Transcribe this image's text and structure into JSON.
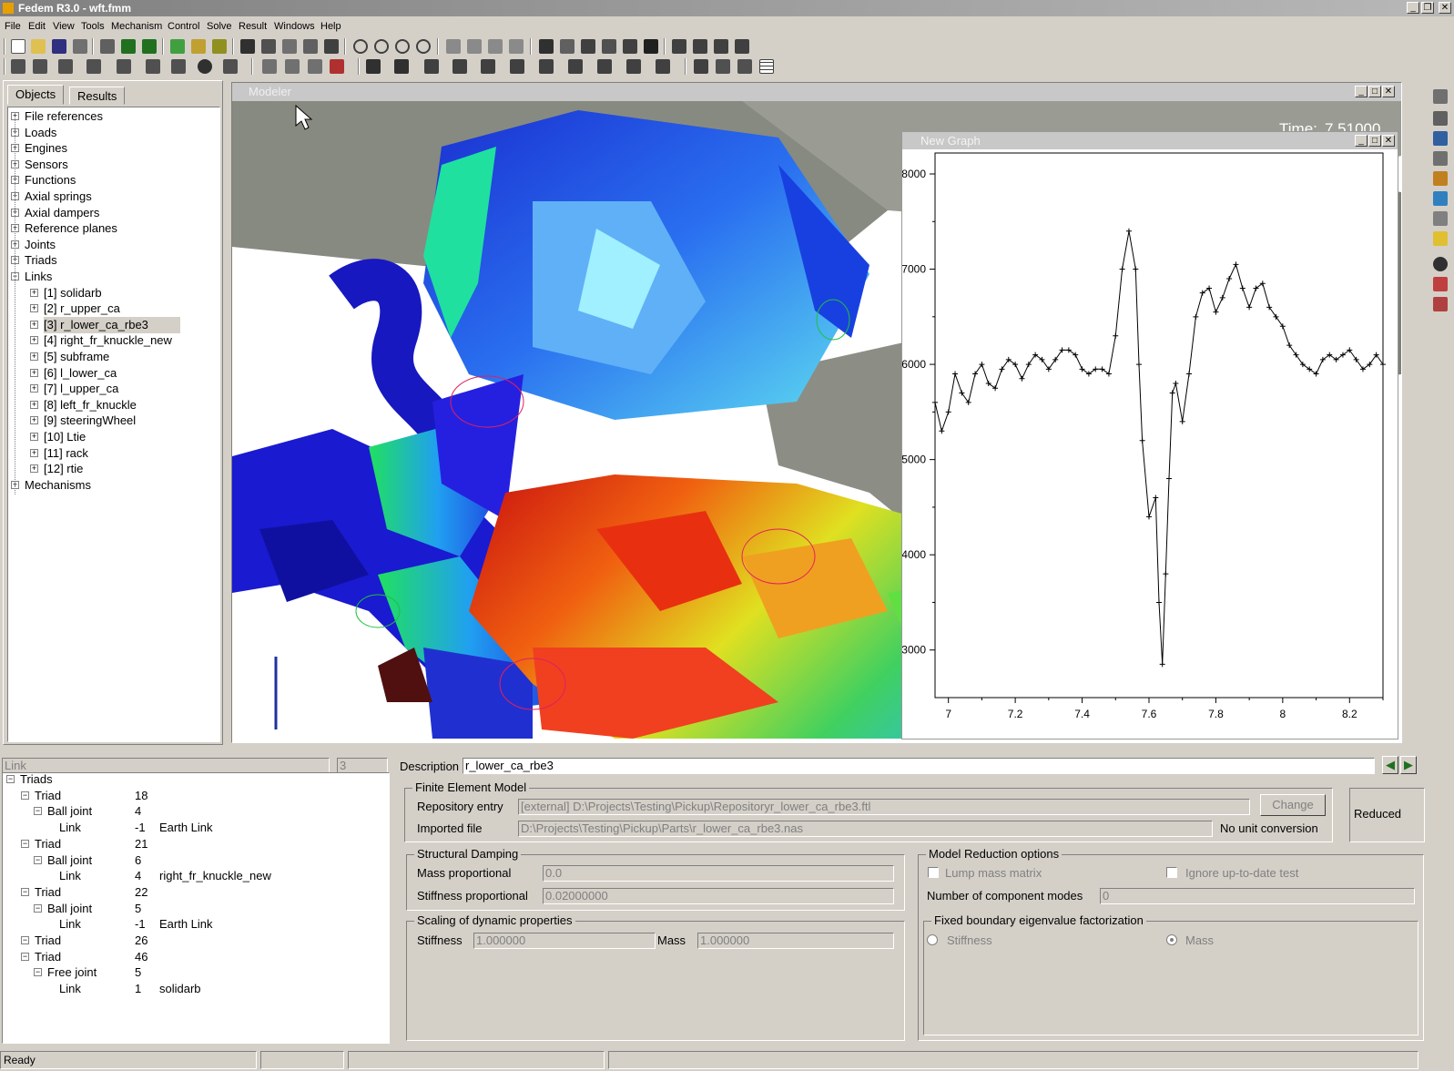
{
  "window": {
    "title": "Fedem R3.0 - wft.fmm"
  },
  "menu": [
    "File",
    "Edit",
    "View",
    "Tools",
    "Mechanism",
    "Control",
    "Solve",
    "Result",
    "Windows",
    "Help"
  ],
  "panel_tabs": {
    "objects": "Objects",
    "results": "Results"
  },
  "tree": [
    {
      "label": "File references",
      "level": 0
    },
    {
      "label": "Loads",
      "level": 0
    },
    {
      "label": "Engines",
      "level": 0
    },
    {
      "label": "Sensors",
      "level": 0
    },
    {
      "label": "Functions",
      "level": 0
    },
    {
      "label": "Axial springs",
      "level": 0
    },
    {
      "label": "Axial dampers",
      "level": 0
    },
    {
      "label": "Reference planes",
      "level": 0
    },
    {
      "label": "Joints",
      "level": 0
    },
    {
      "label": "Triads",
      "level": 0
    },
    {
      "label": "Links",
      "level": 0,
      "expanded": true
    },
    {
      "label": "[1] solidarb",
      "level": 1
    },
    {
      "label": "[2] r_upper_ca",
      "level": 1
    },
    {
      "label": "[3] r_lower_ca_rbe3",
      "level": 1,
      "selected": true
    },
    {
      "label": "[4] right_fr_knuckle_new",
      "level": 1
    },
    {
      "label": "[5] subframe",
      "level": 1
    },
    {
      "label": "[6] l_lower_ca",
      "level": 1
    },
    {
      "label": "[7] l_upper_ca",
      "level": 1
    },
    {
      "label": "[8] left_fr_knuckle",
      "level": 1
    },
    {
      "label": "[9] steeringWheel",
      "level": 1
    },
    {
      "label": "[10] Ltie",
      "level": 1
    },
    {
      "label": "[11] rack",
      "level": 1
    },
    {
      "label": "[12] rtie",
      "level": 1
    },
    {
      "label": "Mechanisms",
      "level": 0
    }
  ],
  "modeler": {
    "title": "Modeler",
    "time_label": "Time:",
    "time_value": "7.51000"
  },
  "graph": {
    "title": "New Graph"
  },
  "chart_data": {
    "type": "line",
    "title": "",
    "xlabel": "",
    "ylabel": "",
    "xlim": [
      6.96,
      8.3
    ],
    "ylim": [
      2500,
      8220
    ],
    "xticks": [
      7,
      7.2,
      7.4,
      7.6,
      7.8,
      8,
      8.2
    ],
    "xtick_labels": [
      "7",
      "7.2",
      "7.4",
      "7.6",
      "7.8",
      "8",
      "8.2"
    ],
    "yticks": [
      3000,
      4000,
      5000,
      6000,
      7000,
      8000
    ],
    "ytick_labels": [
      "3000",
      "4000",
      "5000",
      "6000",
      "7000",
      "8000"
    ],
    "grid": false,
    "marker": "+",
    "series": [
      {
        "x": [
          6.96,
          6.98,
          7.0,
          7.02,
          7.04,
          7.06,
          7.08,
          7.1,
          7.12,
          7.14,
          7.16,
          7.18,
          7.2,
          7.22,
          7.24,
          7.26,
          7.28,
          7.3,
          7.32,
          7.34,
          7.36,
          7.38,
          7.4,
          7.42,
          7.44,
          7.46,
          7.48,
          7.5,
          7.52,
          7.54,
          7.56,
          7.57,
          7.58,
          7.6,
          7.62,
          7.63,
          7.64,
          7.65,
          7.66,
          7.67,
          7.68,
          7.7,
          7.72,
          7.74,
          7.76,
          7.78,
          7.8,
          7.82,
          7.84,
          7.86,
          7.88,
          7.9,
          7.92,
          7.94,
          7.96,
          7.98,
          8.0,
          8.02,
          8.04,
          8.06,
          8.08,
          8.1,
          8.12,
          8.14,
          8.16,
          8.18,
          8.2,
          8.22,
          8.24,
          8.26,
          8.28,
          8.3
        ],
        "values": [
          5600,
          5300,
          5500,
          5900,
          5700,
          5600,
          5900,
          6000,
          5800,
          5750,
          5950,
          6050,
          6000,
          5850,
          6000,
          6100,
          6050,
          5950,
          6050,
          6150,
          6150,
          6100,
          5950,
          5900,
          5950,
          5950,
          5900,
          6300,
          7000,
          7400,
          7000,
          6000,
          5200,
          4400,
          4600,
          3500,
          2850,
          3800,
          4800,
          5700,
          5800,
          5400,
          5900,
          6500,
          6750,
          6800,
          6550,
          6700,
          6900,
          7050,
          6800,
          6600,
          6800,
          6850,
          6600,
          6500,
          6400,
          6200,
          6100,
          6000,
          5950,
          5900,
          6050,
          6100,
          6050,
          6100,
          6150,
          6050,
          5950,
          6000,
          6100,
          6000
        ]
      }
    ]
  },
  "link_bar": {
    "type_label": "Link",
    "id_value": "3",
    "description_label": "Description",
    "description_value": "r_lower_ca_rbe3"
  },
  "triads_tree": [
    {
      "label": "Triads",
      "value": "",
      "extra": "",
      "level": 0
    },
    {
      "label": "Triad",
      "value": "18",
      "extra": "",
      "level": 1
    },
    {
      "label": "Ball joint",
      "value": "4",
      "extra": "",
      "level": 2
    },
    {
      "label": "Link",
      "value": "-1",
      "extra": "Earth Link",
      "level": 3
    },
    {
      "label": "Triad",
      "value": "21",
      "extra": "",
      "level": 1
    },
    {
      "label": "Ball joint",
      "value": "6",
      "extra": "",
      "level": 2
    },
    {
      "label": "Link",
      "value": "4",
      "extra": "right_fr_knuckle_new",
      "level": 3
    },
    {
      "label": "Triad",
      "value": "22",
      "extra": "",
      "level": 1
    },
    {
      "label": "Ball joint",
      "value": "5",
      "extra": "",
      "level": 2
    },
    {
      "label": "Link",
      "value": "-1",
      "extra": "Earth Link",
      "level": 3
    },
    {
      "label": "Triad",
      "value": "26",
      "extra": "",
      "level": 1
    },
    {
      "label": "Triad",
      "value": "46",
      "extra": "",
      "level": 1
    },
    {
      "label": "Free joint",
      "value": "5",
      "extra": "",
      "level": 2
    },
    {
      "label": "Link",
      "value": "1",
      "extra": "solidarb",
      "level": 3
    }
  ],
  "fem": {
    "group_title": "Finite Element Model",
    "repo_label": "Repository entry",
    "repo_value": "[external] D:\\Projects\\Testing\\Pickup\\Repositoryr_lower_ca_rbe3.ftl",
    "change_button": "Change",
    "imported_label": "Imported file",
    "imported_value": "D:\\Projects\\Testing\\Pickup\\Parts\\r_lower_ca_rbe3.nas",
    "unit_text": "No unit conversion",
    "reduced_label": "Reduced"
  },
  "damping": {
    "group_title": "Structural Damping",
    "mass_label": "Mass proportional",
    "mass_value": "0.0",
    "stiff_label": "Stiffness proportional",
    "stiff_value": "0.02000000"
  },
  "scaling": {
    "group_title": "Scaling of dynamic properties",
    "stiff_label": "Stiffness",
    "stiff_value": "1.000000",
    "mass_label": "Mass",
    "mass_value": "1.000000"
  },
  "reduction": {
    "group_title": "Model Reduction options",
    "lump_label": "Lump mass matrix",
    "ignore_label": "Ignore up-to-date test",
    "modes_label": "Number of component modes",
    "modes_value": "0",
    "eigen_title": "Fixed boundary eigenvalue factorization",
    "stiffness_label": "Stiffness",
    "mass_label": "Mass"
  },
  "status": {
    "text": "Ready"
  }
}
